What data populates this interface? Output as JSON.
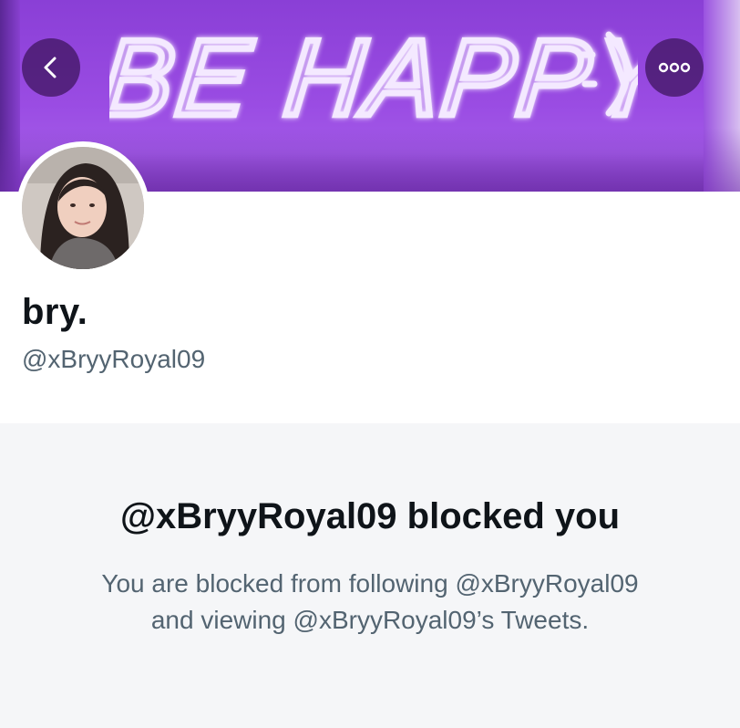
{
  "banner": {
    "neon_text": "BE HAPPY",
    "neon_emoticon": ":)",
    "colors": {
      "purple": "#9a4ce3",
      "neon": "#f4e9ff"
    }
  },
  "nav": {
    "back_icon": "chevron-left-icon",
    "more_icon": "more-horizontal-icon"
  },
  "profile": {
    "display_name": "bry.",
    "handle": "@xBryyRoyal09"
  },
  "blocked": {
    "title": "@xBryyRoyal09 blocked you",
    "line1": "You are blocked from following @xBryyRoyal09",
    "line2": "and viewing @xBryyRoyal09’s Tweets."
  },
  "colors": {
    "text_primary": "#0f1419",
    "text_secondary": "#536471",
    "blocked_background": "#f5f6f8"
  }
}
